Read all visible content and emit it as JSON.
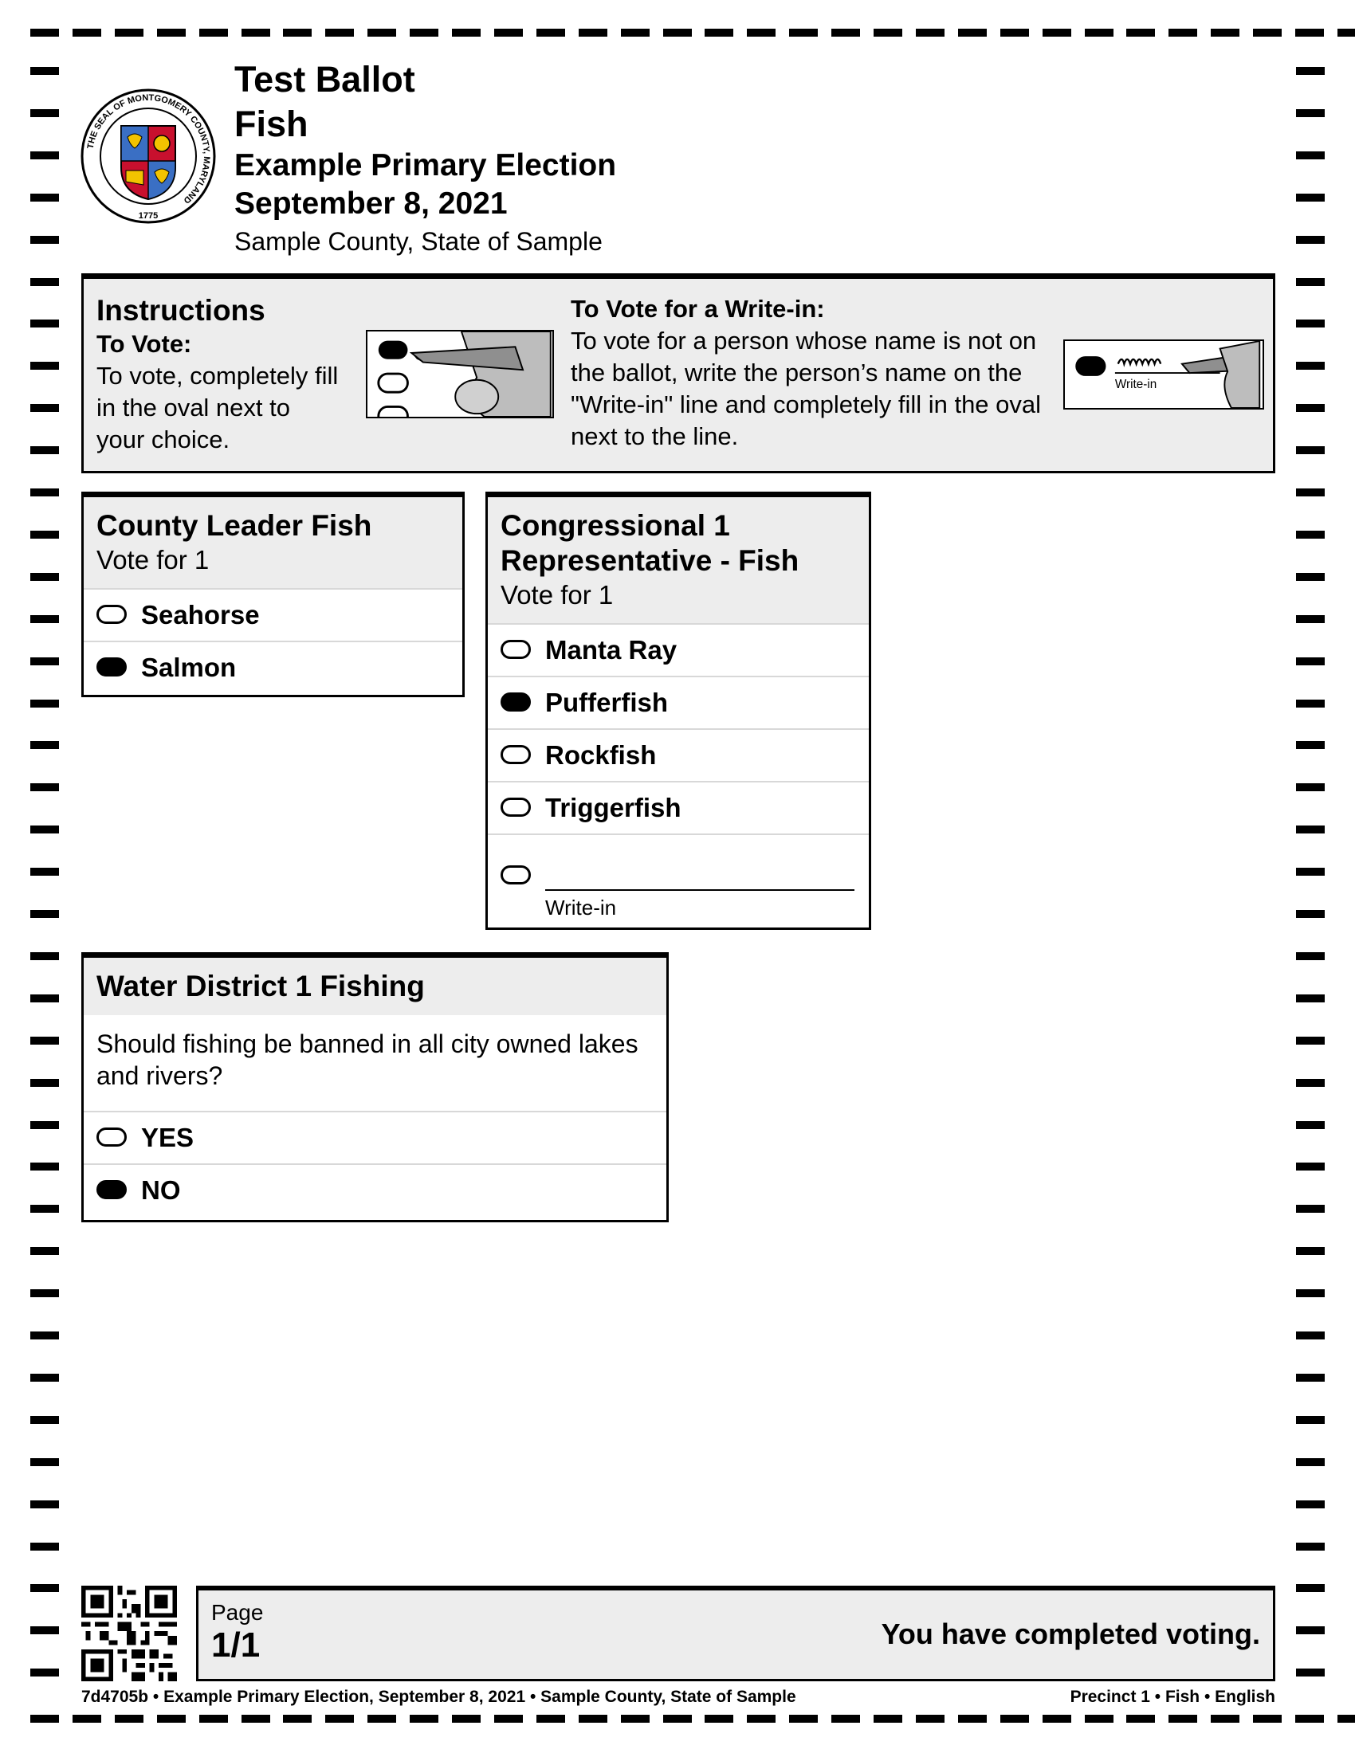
{
  "header": {
    "ballot_title": "Test Ballot",
    "party": "Fish",
    "election_name": "Example Primary Election",
    "election_date": "September 8, 2021",
    "jurisdiction": "Sample County, State of Sample",
    "seal": {
      "ring_text": "THE SEAL OF MONTGOMERY COUNTY, MARYLAND",
      "year": "1775"
    }
  },
  "instructions": {
    "heading": "Instructions",
    "to_vote_heading": "To Vote:",
    "to_vote_text": "To vote, completely fill in the oval next to your choice.",
    "write_in_heading": "To Vote for a Write-in:",
    "write_in_text": "To vote for a person whose name is not on the ballot, write the person’s name on the \"Write-in\" line and completely fill in the oval next to the line.",
    "illustration_label": "Write-in"
  },
  "contests": {
    "county_leader": {
      "title": "County Leader Fish",
      "vote_for": "Vote for 1",
      "options": [
        {
          "label": "Seahorse",
          "filled": false
        },
        {
          "label": "Salmon",
          "filled": true
        }
      ]
    },
    "congressional": {
      "title_line1": "Congressional 1",
      "title_line2": "Representative - Fish",
      "vote_for": "Vote for 1",
      "options": [
        {
          "label": "Manta Ray",
          "filled": false
        },
        {
          "label": "Pufferfish",
          "filled": true
        },
        {
          "label": "Rockfish",
          "filled": false
        },
        {
          "label": "Triggerfish",
          "filled": false
        }
      ],
      "write_in_label": "Write-in"
    },
    "water_district": {
      "title": "Water District 1 Fishing",
      "question": "Should fishing be banned in all city owned lakes and rivers?",
      "options": [
        {
          "label": "YES",
          "filled": false
        },
        {
          "label": "NO",
          "filled": true
        }
      ]
    }
  },
  "footer": {
    "page_label": "Page",
    "page_number": "1/1",
    "completion_message": "You have completed voting.",
    "left_meta": "7d4705b • Example Primary Election, September 8, 2021 • Sample County, State of Sample",
    "right_meta": "Precinct 1 • Fish • English"
  }
}
